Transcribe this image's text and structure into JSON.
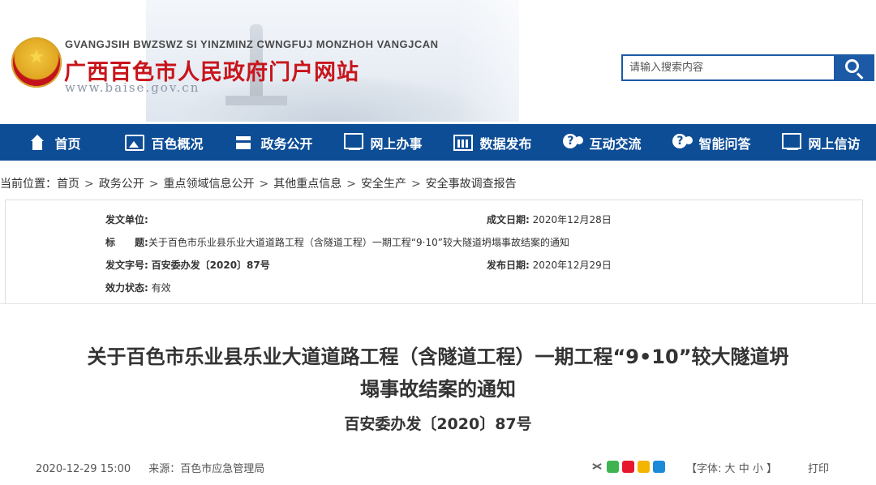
{
  "header": {
    "pinyin": "GVANGJSIH BWZSWZ SI YINZMINZ CWNGFUJ MONZHOH VANGJCAN",
    "title": "广西百色市人民政府门户网站",
    "url": "www.baise.gov.cn",
    "search_placeholder": "请输入搜索内容",
    "search_icon": "search-icon",
    "brand_color": "#0d4d96",
    "title_color": "#c8151b"
  },
  "nav": {
    "items": [
      {
        "label": "首页",
        "icon": "home-icon"
      },
      {
        "label": "百色概况",
        "icon": "picture-icon"
      },
      {
        "label": "政务公开",
        "icon": "document-icon"
      },
      {
        "label": "网上办事",
        "icon": "monitor-icon"
      },
      {
        "label": "数据发布",
        "icon": "chart-icon"
      },
      {
        "label": "互动交流",
        "icon": "chat-icon"
      },
      {
        "label": "智能问答",
        "icon": "chat-icon"
      },
      {
        "label": "网上信访",
        "icon": "monitor-icon"
      }
    ]
  },
  "breadcrumb": {
    "prefix": "当前位置：",
    "items": [
      "首页",
      "政务公开",
      "重点领域信息公开",
      "其他重点信息",
      "安全生产",
      "安全事故调查报告"
    ],
    "separator": ">"
  },
  "meta": {
    "issuer_label": "发文单位:",
    "issuer_value": "",
    "created_label": "成文日期:",
    "created_value": "2020年12月28日",
    "title_label": "标　　题:",
    "title_value": "关于百色市乐业县乐业大道道路工程（含隧道工程）一期工程“9·10”较大隧道坍塌事故结案的通知",
    "docno_label": "发文字号:",
    "docno_value": "百安委办发〔2020〕87号",
    "published_label": "发布日期:",
    "published_value": "2020年12月29日",
    "status_label": "效力状态:",
    "status_value": "有效"
  },
  "article": {
    "title_line1": "关于百色市乐业县乐业大道道路工程（含隧道工程）一期工程“9•10”较大隧道坍",
    "title_line2": "塌事故结案的通知",
    "doc_number": "百安委办发〔2020〕87号",
    "datetime": "2020-12-29 15:00",
    "source": "来源：百色市应急管理局",
    "font_label": "【字体:",
    "font_large": "大",
    "font_medium": "中",
    "font_small": "小",
    "font_close": "】",
    "print": "打印",
    "share_icons": [
      "share-icon",
      "wechat-icon",
      "weibo-icon",
      "qzone-icon",
      "qq-icon"
    ]
  }
}
